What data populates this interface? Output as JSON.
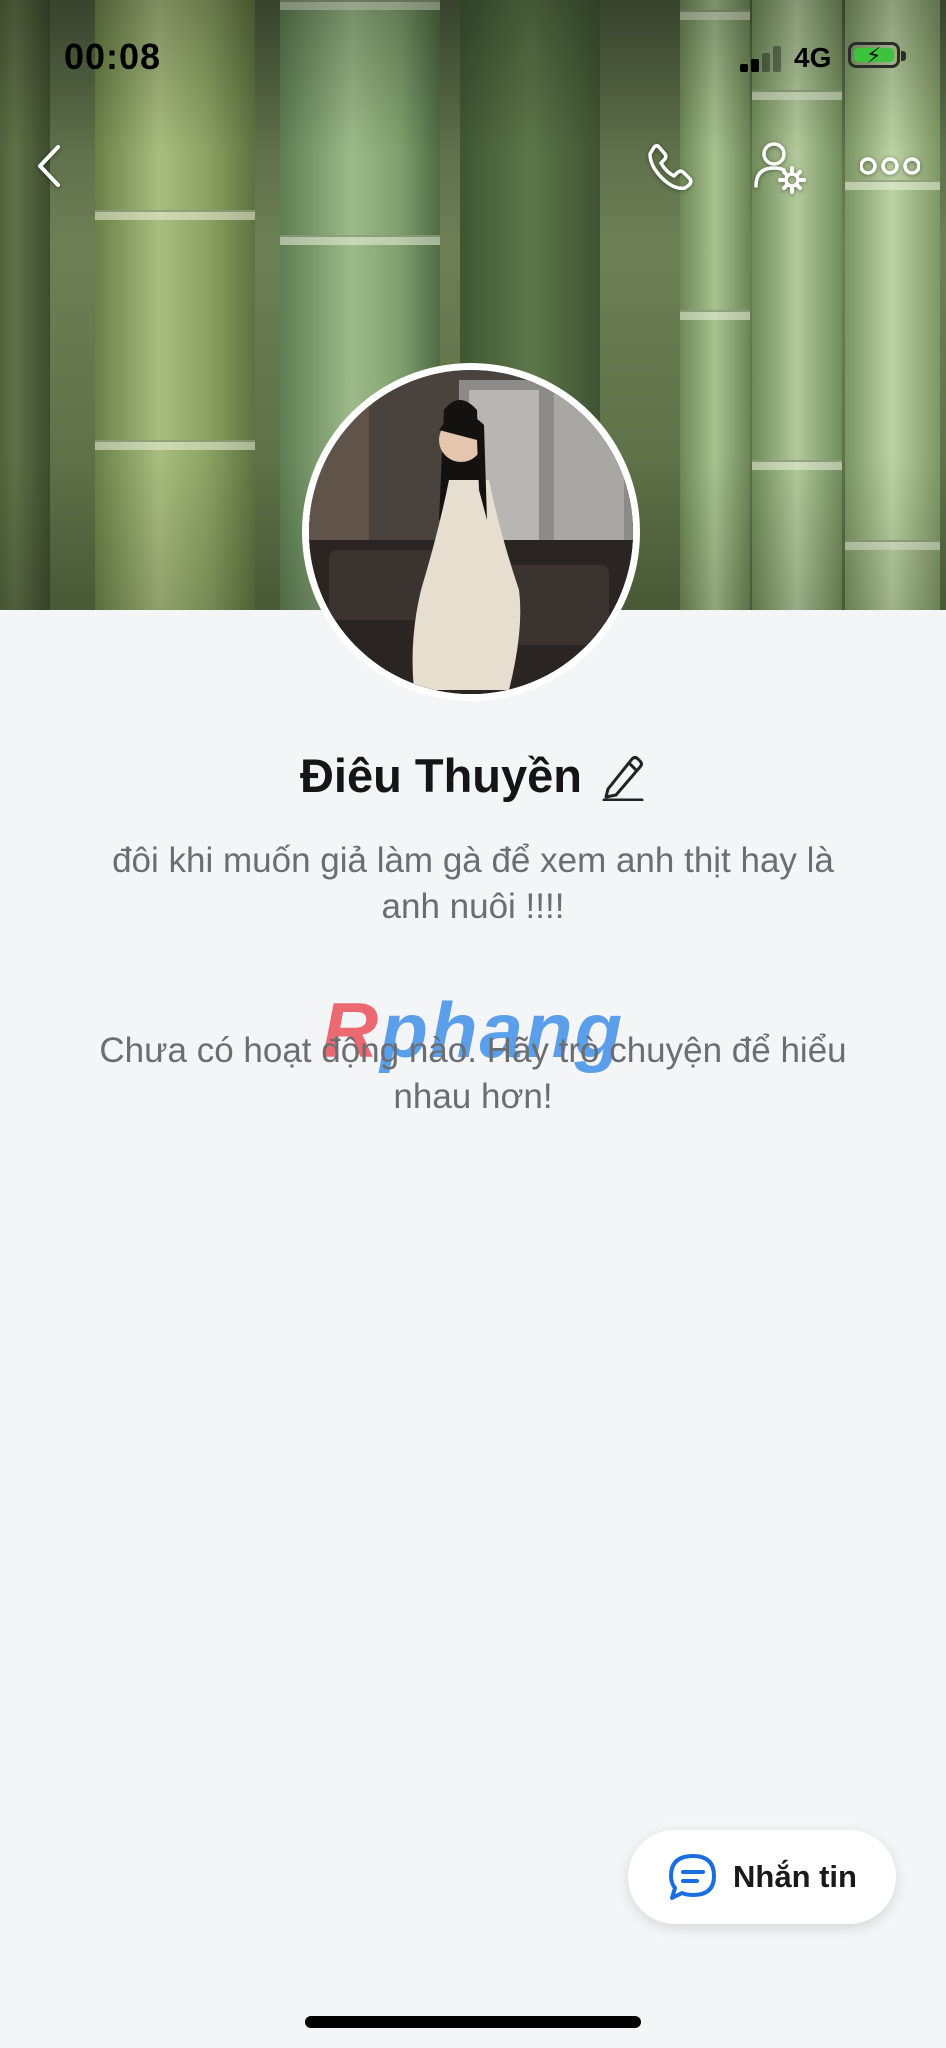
{
  "status_bar": {
    "time": "00:08",
    "network": "4G"
  },
  "header": {
    "back_icon": "chevron-left-icon",
    "call_icon": "phone-icon",
    "profile_settings_icon": "user-gear-icon",
    "more_icon": "more-horizontal-icon"
  },
  "profile": {
    "name": "Điêu Thuyền",
    "edit_icon": "pencil-icon",
    "bio": "đôi khi muốn giả làm gà để xem anh thịt hay là anh nuôi !!!!",
    "empty_activity": "Chưa có hoạt động nào. Hãy trò chuyện để hiểu nhau hơn!"
  },
  "watermark": {
    "text_r": "R",
    "text_rest": "phang"
  },
  "actions": {
    "message_label": "Nhắn tin",
    "message_icon": "chat-bubble-icon"
  },
  "colors": {
    "accent": "#1a6fe0",
    "battery": "#3ec33e",
    "muted_text": "#6b6d70"
  }
}
